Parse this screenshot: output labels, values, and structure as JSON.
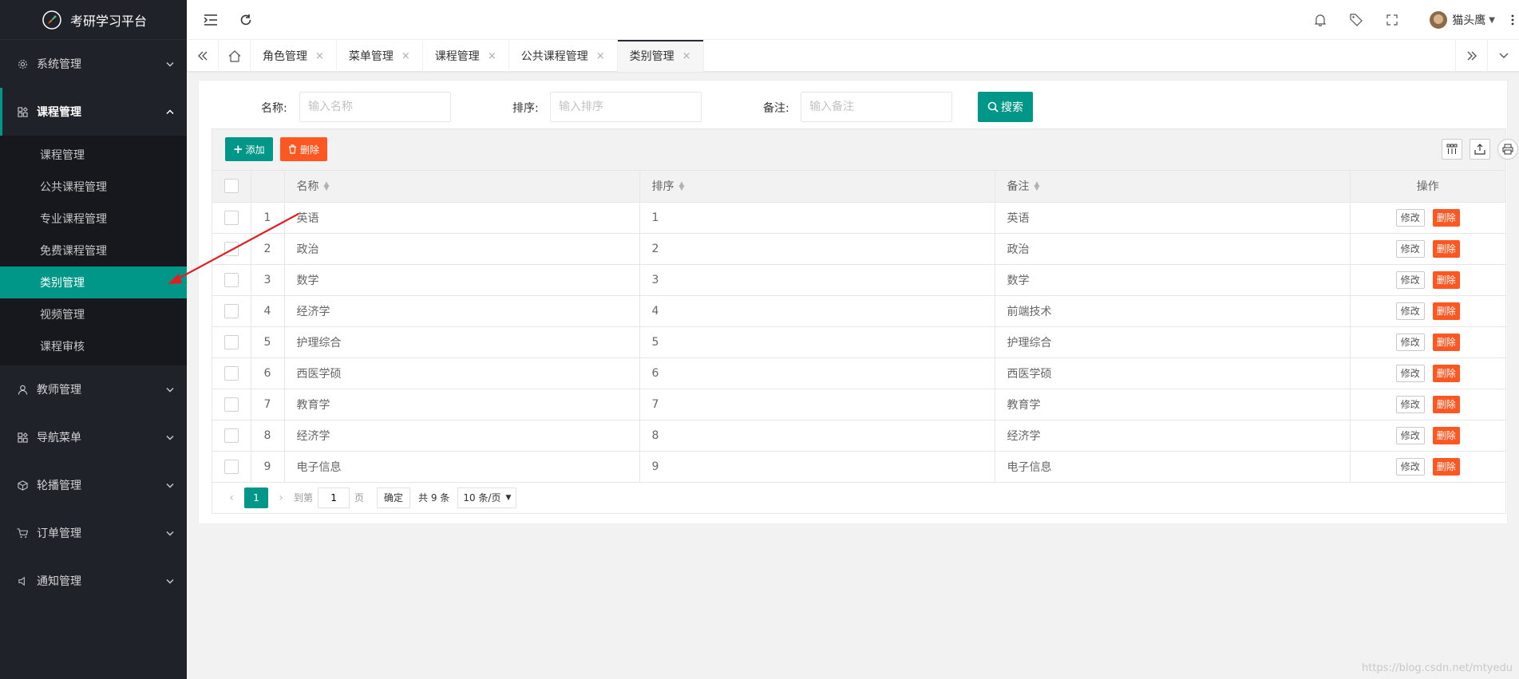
{
  "app": {
    "title": "考研学习平台"
  },
  "sidebar": {
    "menus": [
      {
        "label": "系统管理",
        "icon": "gear-icon"
      },
      {
        "label": "课程管理",
        "icon": "apps-icon",
        "open": true,
        "items": [
          "课程管理",
          "公共课程管理",
          "专业课程管理",
          "免费课程管理",
          "类别管理",
          "视频管理",
          "课程审核"
        ],
        "active": "类别管理"
      },
      {
        "label": "教师管理",
        "icon": "user-icon"
      },
      {
        "label": "导航菜单",
        "icon": "apps-icon"
      },
      {
        "label": "轮播管理",
        "icon": "cube-icon"
      },
      {
        "label": "订单管理",
        "icon": "cart-icon"
      },
      {
        "label": "通知管理",
        "icon": "speaker-icon"
      }
    ]
  },
  "header": {
    "username": "猫头鹰"
  },
  "tabs": [
    {
      "label": "角色管理"
    },
    {
      "label": "菜单管理"
    },
    {
      "label": "课程管理"
    },
    {
      "label": "公共课程管理"
    },
    {
      "label": "类别管理",
      "active": true
    }
  ],
  "search": {
    "name_label": "名称:",
    "name_placeholder": "输入名称",
    "order_label": "排序:",
    "order_placeholder": "输入排序",
    "remark_label": "备注:",
    "remark_placeholder": "输入备注",
    "button": "搜索"
  },
  "toolbar": {
    "add": "添加",
    "delete": "删除"
  },
  "table": {
    "columns": [
      "名称",
      "排序",
      "备注",
      "操作"
    ],
    "edit_label": "修改",
    "delete_label": "删除",
    "rows": [
      {
        "no": "1",
        "name": "英语",
        "order": "1",
        "remark": "英语"
      },
      {
        "no": "2",
        "name": "政治",
        "order": "2",
        "remark": "政治"
      },
      {
        "no": "3",
        "name": "数学",
        "order": "3",
        "remark": "数学"
      },
      {
        "no": "4",
        "name": "经济学",
        "order": "4",
        "remark": "前端技术"
      },
      {
        "no": "5",
        "name": "护理综合",
        "order": "5",
        "remark": "护理综合"
      },
      {
        "no": "6",
        "name": "西医学硕",
        "order": "6",
        "remark": "西医学硕"
      },
      {
        "no": "7",
        "name": "教育学",
        "order": "7",
        "remark": "教育学"
      },
      {
        "no": "8",
        "name": "经济学",
        "order": "8",
        "remark": "经济学"
      },
      {
        "no": "9",
        "name": "电子信息",
        "order": "9",
        "remark": "电子信息"
      }
    ]
  },
  "pager": {
    "current": "1",
    "goto_label": "到第",
    "goto_value": "1",
    "page_label": "页",
    "confirm": "确定",
    "total": "共 9 条",
    "page_size": "10 条/页"
  },
  "watermark": "https://blog.csdn.net/mtyedu",
  "colors": {
    "primary": "#009688",
    "danger": "#ff5722",
    "sidebar": "#20222a",
    "annotation_arrow": "#e02020"
  }
}
